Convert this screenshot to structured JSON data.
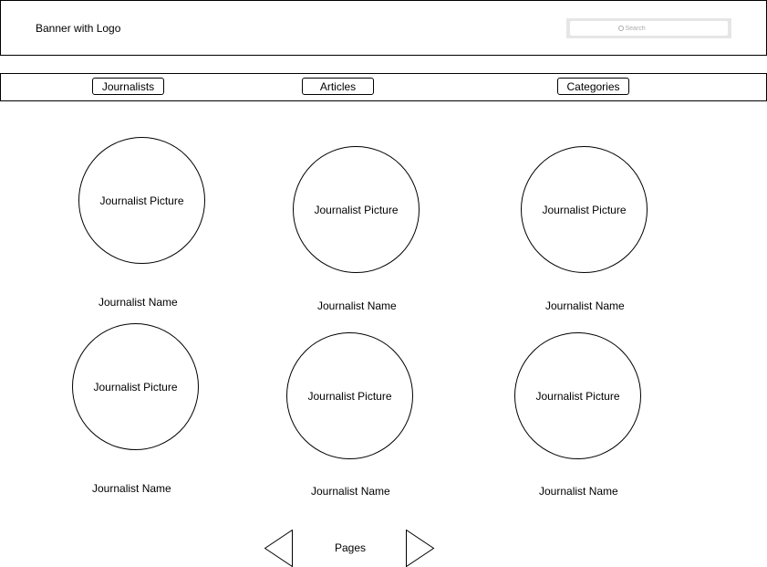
{
  "banner": {
    "title": "Banner with Logo"
  },
  "search": {
    "placeholder": "Search"
  },
  "nav": {
    "items": [
      "Journalists",
      "Articles",
      "Categories"
    ]
  },
  "journalists": [
    {
      "picture": "Journalist Picture",
      "name": "Journalist Name"
    },
    {
      "picture": "Journalist Picture",
      "name": "Journalist Name"
    },
    {
      "picture": "Journalist Picture",
      "name": "Journalist Name"
    },
    {
      "picture": "Journalist Picture",
      "name": "Journalist Name"
    },
    {
      "picture": "Journalist Picture",
      "name": "Journalist Name"
    },
    {
      "picture": "Journalist Picture",
      "name": "Journalist Name"
    }
  ],
  "pagination": {
    "label": "Pages"
  }
}
